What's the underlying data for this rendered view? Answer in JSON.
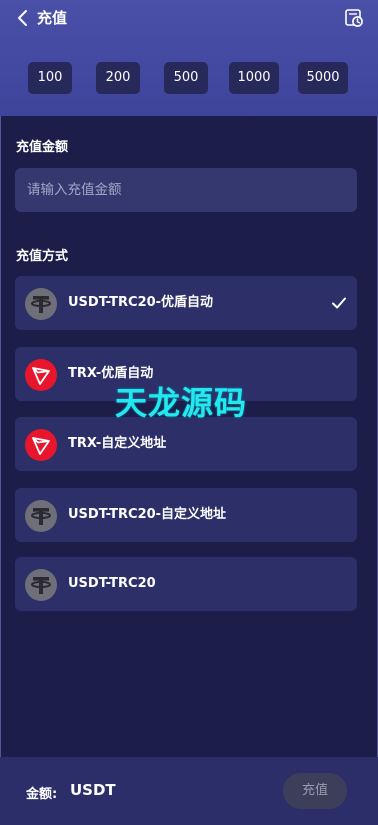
{
  "header": {
    "back_icon": "chevron-left-icon",
    "title": "充值",
    "history_icon": "clock-history-icon",
    "quick_amounts": [
      "100",
      "200",
      "500",
      "1000",
      "5000"
    ]
  },
  "amount_section": {
    "label": "充值金额",
    "placeholder": "请输入充值金额"
  },
  "method_section": {
    "label": "充值方式",
    "methods": [
      {
        "label": "USDT-TRC20-优盾自动",
        "icon": "tether-icon",
        "selected": true
      },
      {
        "label": "TRX-优盾自动",
        "icon": "tron-icon",
        "selected": false
      },
      {
        "label": "TRX-自定义地址",
        "icon": "tron-icon",
        "selected": false
      },
      {
        "label": "USDT-TRC20-自定义地址",
        "icon": "tether-icon",
        "selected": false
      },
      {
        "label": "USDT-TRC20",
        "icon": "tether-icon",
        "selected": false
      }
    ]
  },
  "watermark": "天龙源码",
  "footer": {
    "amount_label": "金额:",
    "currency": "USDT",
    "submit_label": "充值"
  },
  "colors": {
    "header": "#4a4fa8",
    "background": "#1c1d49",
    "card": "#2c2f68",
    "tron_red": "#e8162c",
    "tether_gray": "#6e6f78",
    "watermark": "#22e9f0"
  }
}
